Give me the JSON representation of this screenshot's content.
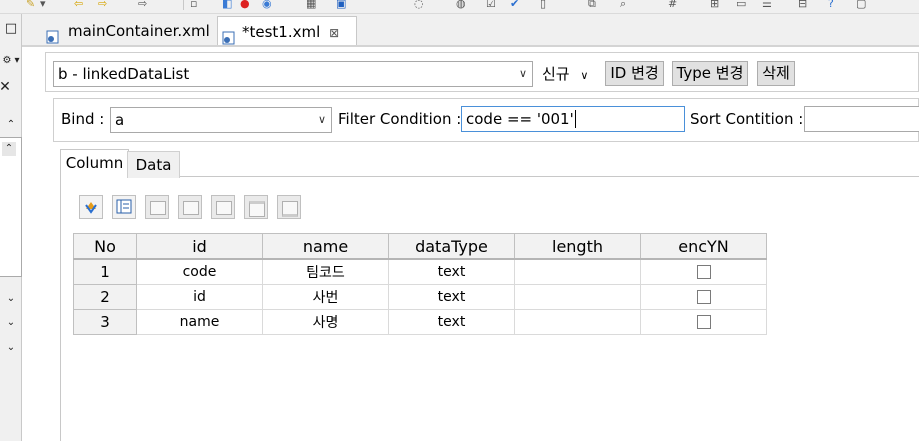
{
  "tabs": [
    {
      "label": "mainContainer.xml"
    },
    {
      "label": "*test1.xml",
      "close": "⊠"
    }
  ],
  "datalist": {
    "value": "b - linkedDataList",
    "new_label": "신규",
    "id_change": "ID 변경",
    "type_change": "Type 변경",
    "delete": "삭제"
  },
  "bind": {
    "label": "Bind :",
    "value": "a",
    "filter_label": "Filter Condition :",
    "filter_value": "code == '001'",
    "sort_label": "Sort Contition :"
  },
  "inner_tabs": {
    "column": "Column",
    "data": "Data"
  },
  "grid": {
    "headers": [
      "No",
      "id",
      "name",
      "dataType",
      "length",
      "encYN"
    ],
    "rows": [
      {
        "no": "1",
        "id": "code",
        "name": "팀코드",
        "dataType": "text",
        "length": ""
      },
      {
        "no": "2",
        "id": "id",
        "name": "사번",
        "dataType": "text",
        "length": ""
      },
      {
        "no": "3",
        "id": "name",
        "name": "사명",
        "dataType": "text",
        "length": ""
      }
    ]
  },
  "colors": {
    "accent_border": "#4a90d9",
    "header_bg": "#f2f2f2"
  }
}
